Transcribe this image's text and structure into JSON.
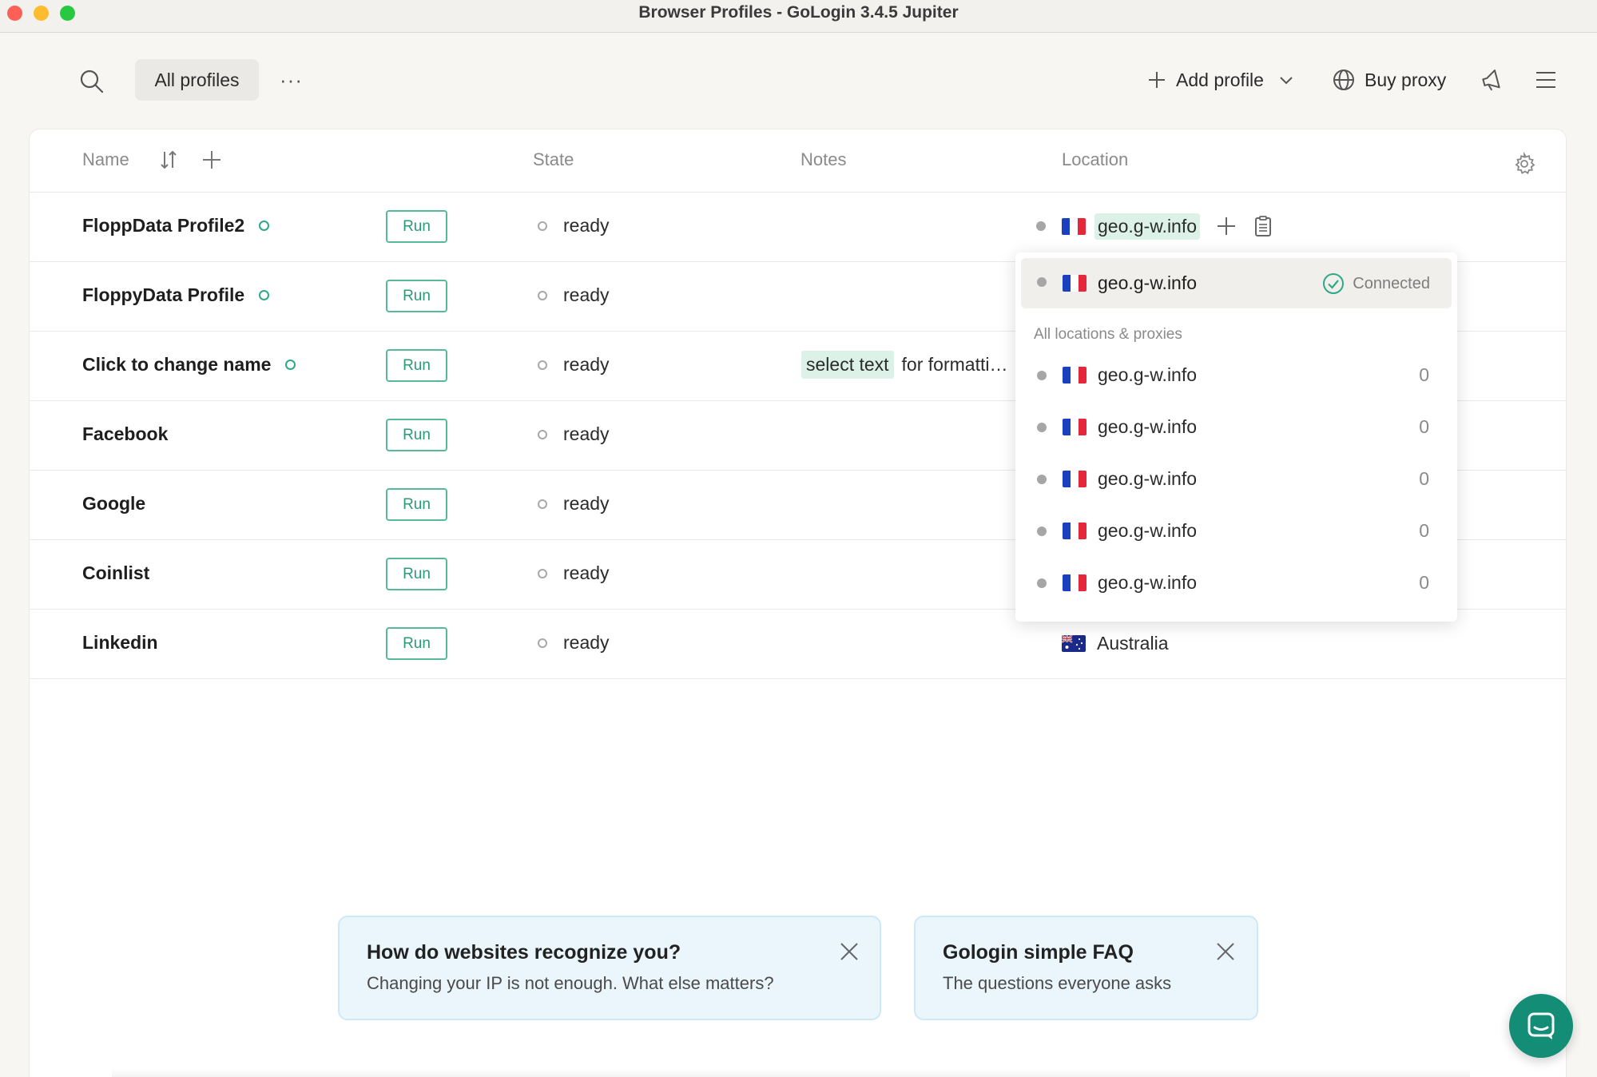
{
  "window": {
    "title": "Browser Profiles - GoLogin 3.4.5 Jupiter"
  },
  "toolbar": {
    "filter_label": "All profiles",
    "more_label": "···",
    "add_profile_label": "Add profile",
    "buy_proxy_label": "Buy proxy"
  },
  "table": {
    "columns": {
      "name": "Name",
      "state": "State",
      "notes": "Notes",
      "location": "Location"
    },
    "rows": [
      {
        "name": "FloppData Profile2",
        "run_label": "Run",
        "state": "ready",
        "notes_highlight": "",
        "notes_rest": "",
        "location": "geo.g-w.info",
        "flag": "fr"
      },
      {
        "name": "FloppyData Profile",
        "run_label": "Run",
        "state": "ready",
        "notes_highlight": "",
        "notes_rest": "",
        "location": "",
        "flag": ""
      },
      {
        "name": "Click to change name",
        "run_label": "Run",
        "state": "ready",
        "notes_highlight": "select text",
        "notes_rest": "for formatti…",
        "location": "",
        "flag": ""
      },
      {
        "name": "Facebook",
        "run_label": "Run",
        "state": "ready",
        "notes_highlight": "",
        "notes_rest": "",
        "location": "",
        "flag": ""
      },
      {
        "name": "Google",
        "run_label": "Run",
        "state": "ready",
        "notes_highlight": "",
        "notes_rest": "",
        "location": "",
        "flag": ""
      },
      {
        "name": "Coinlist",
        "run_label": "Run",
        "state": "ready",
        "notes_highlight": "",
        "notes_rest": "",
        "location": "",
        "flag": ""
      },
      {
        "name": "Linkedin",
        "run_label": "Run",
        "state": "ready",
        "notes_highlight": "",
        "notes_rest": "",
        "location": "Australia",
        "flag": "au"
      }
    ]
  },
  "location_dropdown": {
    "selected": {
      "host": "geo.g-w.info",
      "status": "Connected"
    },
    "section_label": "All locations & proxies",
    "items": [
      {
        "host": "geo.g-w.info",
        "count": "0"
      },
      {
        "host": "geo.g-w.info",
        "count": "0"
      },
      {
        "host": "geo.g-w.info",
        "count": "0"
      },
      {
        "host": "geo.g-w.info",
        "count": "0"
      },
      {
        "host": "geo.g-w.info",
        "count": "0"
      }
    ]
  },
  "banners": [
    {
      "title": "How do websites recognize you?",
      "subtitle": "Changing your IP is not enough. What else matters?"
    },
    {
      "title": "Gologin simple FAQ",
      "subtitle": "The questions everyone asks"
    }
  ],
  "colors": {
    "accent": "#2a9b79",
    "highlight": "#dcf2e8",
    "chat": "#138d76",
    "banner_bg": "#eaf6fb"
  }
}
